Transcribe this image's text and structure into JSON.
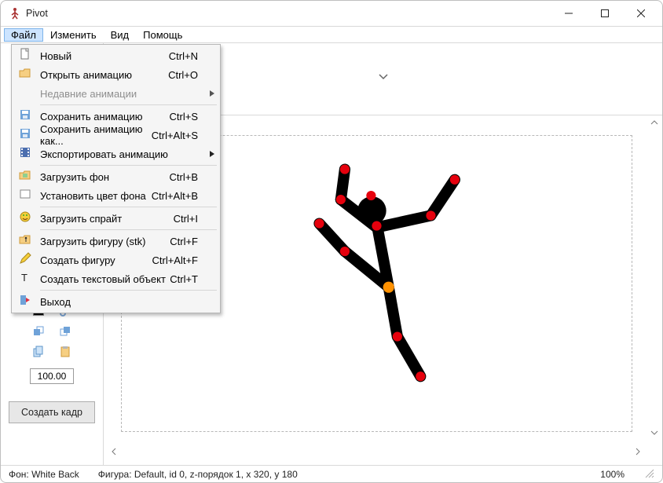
{
  "title": "Pivot",
  "menubar": {
    "file": "Файл",
    "edit": "Изменить",
    "view": "Вид",
    "help": "Помощь"
  },
  "menu": {
    "new": "Новый",
    "new_sc": "Ctrl+N",
    "open": "Открыть анимацию",
    "open_sc": "Ctrl+O",
    "recent": "Недавние анимации",
    "save": "Сохранить анимацию",
    "save_sc": "Ctrl+S",
    "saveas": "Сохранить анимацию как...",
    "saveas_sc": "Ctrl+Alt+S",
    "export": "Экспортировать анимацию",
    "loadbg": "Загрузить фон",
    "loadbg_sc": "Ctrl+B",
    "bgcolor": "Установить цвет фона",
    "bgcolor_sc": "Ctrl+Alt+B",
    "sprite": "Загрузить спрайт",
    "sprite_sc": "Ctrl+I",
    "loadfig": "Загрузить фигуру (stk)",
    "loadfig_sc": "Ctrl+F",
    "createfig": "Создать фигуру",
    "createfig_sc": "Ctrl+Alt+F",
    "textobj": "Создать текстовый объект",
    "textobj_sc": "Ctrl+T",
    "exit": "Выход"
  },
  "sidebar": {
    "scale_value": "100.00",
    "create_frame": "Создать кадр"
  },
  "status": {
    "bg": "Фон: White Back",
    "figure": "Фигура: Default,  id 0,  z-порядок 1,  x 320, y 180",
    "zoom": "100%"
  }
}
